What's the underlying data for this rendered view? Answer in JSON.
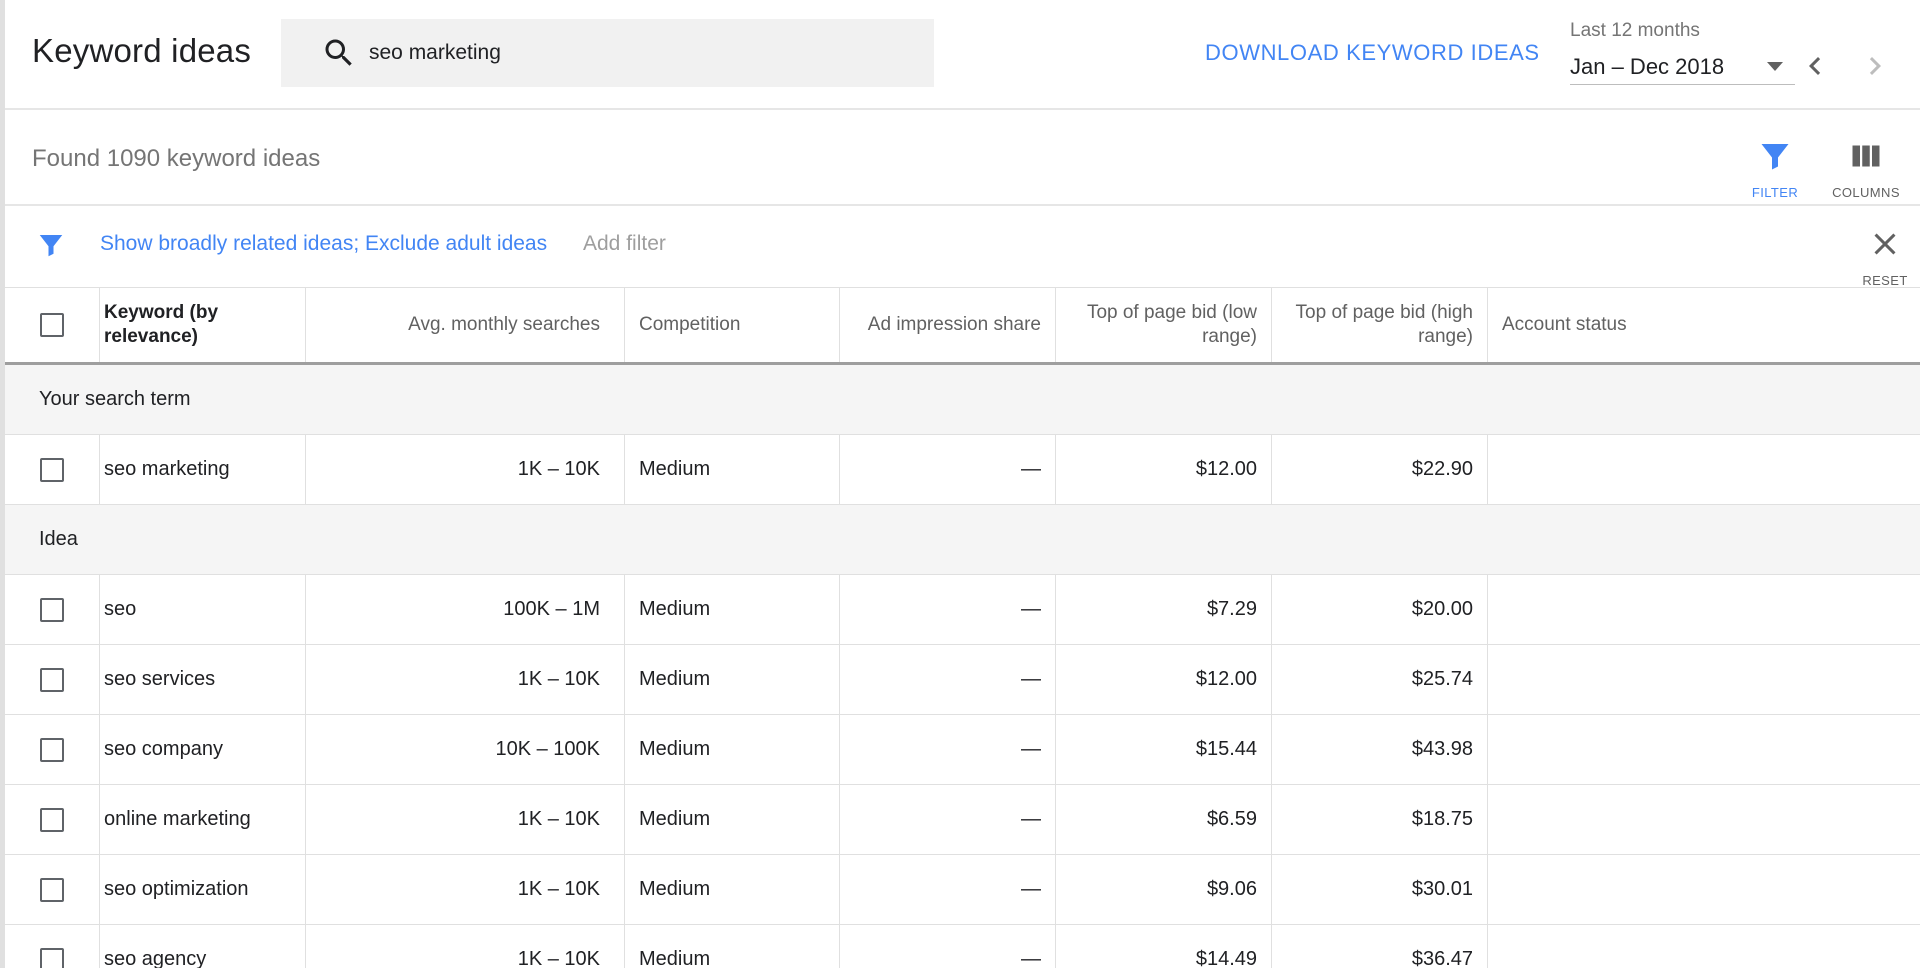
{
  "header": {
    "title": "Keyword ideas",
    "search_value": "seo marketing",
    "download_label": "DOWNLOAD KEYWORD IDEAS",
    "date_range_label": "Last 12 months",
    "date_range_value": "Jan – Dec 2018"
  },
  "summary": {
    "found_text": "Found 1090 keyword ideas",
    "filter_label": "FILTER",
    "columns_label": "COLUMNS"
  },
  "filters": {
    "active_summary": "Show broadly related ideas; Exclude adult ideas",
    "add_filter_label": "Add filter",
    "reset_label": "RESET"
  },
  "table": {
    "columns": {
      "keyword": "Keyword (by relevance)",
      "avg_searches": "Avg. monthly searches",
      "competition": "Competition",
      "ad_impression": "Ad impression share",
      "bid_low": "Top of page bid (low range)",
      "bid_high": "Top of page bid (high range)",
      "account_status": "Account status"
    },
    "search_term_section": "Your search term",
    "search_term_row": {
      "keyword": "seo marketing",
      "avg": "1K – 10K",
      "comp": "Medium",
      "adimp": "—",
      "low": "$12.00",
      "high": "$22.90",
      "status": ""
    },
    "idea_section": "Idea",
    "idea_rows": [
      {
        "keyword": "seo",
        "avg": "100K – 1M",
        "comp": "Medium",
        "adimp": "—",
        "low": "$7.29",
        "high": "$20.00",
        "status": ""
      },
      {
        "keyword": "seo services",
        "avg": "1K – 10K",
        "comp": "Medium",
        "adimp": "—",
        "low": "$12.00",
        "high": "$25.74",
        "status": ""
      },
      {
        "keyword": "seo company",
        "avg": "10K – 100K",
        "comp": "Medium",
        "adimp": "—",
        "low": "$15.44",
        "high": "$43.98",
        "status": ""
      },
      {
        "keyword": "online marketing",
        "avg": "1K – 10K",
        "comp": "Medium",
        "adimp": "—",
        "low": "$6.59",
        "high": "$18.75",
        "status": ""
      },
      {
        "keyword": "seo optimization",
        "avg": "1K – 10K",
        "comp": "Medium",
        "adimp": "—",
        "low": "$9.06",
        "high": "$30.01",
        "status": ""
      },
      {
        "keyword": "seo agency",
        "avg": "1K – 10K",
        "comp": "Medium",
        "adimp": "—",
        "low": "$14.49",
        "high": "$36.47",
        "status": ""
      }
    ]
  },
  "colors": {
    "accent": "#4285f4",
    "section_bg": "#f5f5f5",
    "muted_text": "#757575"
  }
}
